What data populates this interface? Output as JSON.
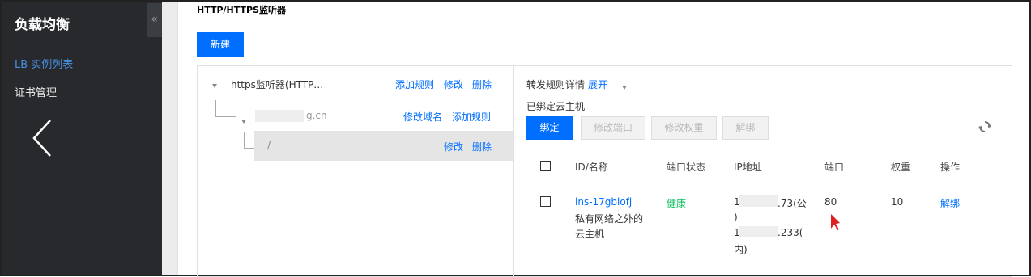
{
  "sidebar": {
    "title": "负载均衡",
    "collapse_glyph": "«",
    "items": [
      {
        "label": "LB 实例列表",
        "active": true
      },
      {
        "label": "证书管理",
        "active": false
      }
    ]
  },
  "page_title": "HTTP/HTTPS监听器",
  "new_button": "新建",
  "tree": {
    "listener": {
      "label": "https监听器(HTTP…",
      "actions": [
        "添加规则",
        "修改",
        "删除"
      ]
    },
    "domain": {
      "label_suffix": "g.cn",
      "actions": [
        "修改域名",
        "添加规则"
      ]
    },
    "path": {
      "label": "/",
      "actions": [
        "修改",
        "删除"
      ]
    }
  },
  "detail": {
    "rule_details_label": "转发规则详情",
    "expand_label": "展开",
    "bound_hosts_label": "已绑定云主机",
    "buttons": {
      "bind": "绑定",
      "modify_port": "修改端口",
      "modify_weight": "修改权重",
      "unbind": "解绑"
    },
    "columns": [
      "ID/名称",
      "端口状态",
      "IP地址",
      "端口",
      "权重",
      "操作"
    ],
    "rows": [
      {
        "id": "ins-17gblofj",
        "name_line1": "私有网络之外的",
        "name_line2": "云主机",
        "status": "健康",
        "ip_public_suffix": ".73(公",
        "ip_public_close": ")",
        "ip_private_prefix": "1",
        "ip_private_suffix": ".233(",
        "ip_private_close": "内)",
        "ip_public_prefix": "1",
        "port": "80",
        "weight": "10",
        "action": "解绑"
      }
    ]
  },
  "colors": {
    "accent": "#006eff",
    "healthy": "#0abf5b",
    "sidebar_bg": "#27292d"
  }
}
